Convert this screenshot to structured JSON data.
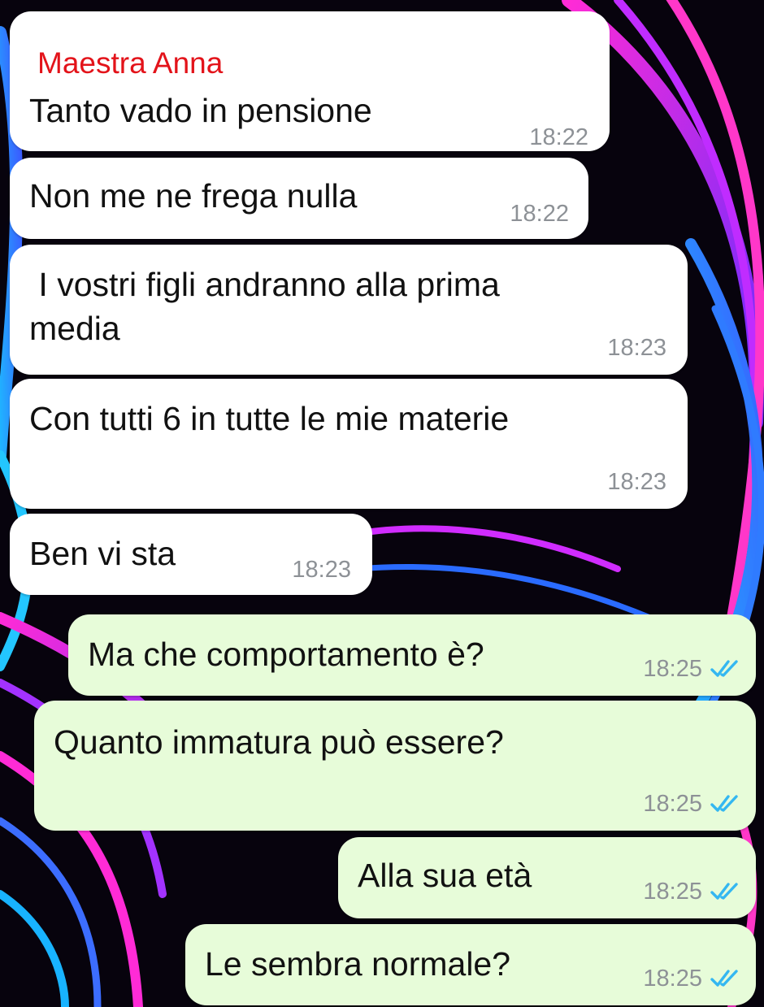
{
  "colors": {
    "incoming_bubble": "#ffffff",
    "outgoing_bubble": "#e7fcd9",
    "sender_name": "#e3131a",
    "timestamp": "#8d9196",
    "read_ticks": "#34b7f1"
  },
  "messages": [
    {
      "direction": "in",
      "sender": "Maestra Anna",
      "text": "Tanto vado in pensione",
      "time": "18:22"
    },
    {
      "direction": "in",
      "text": "Non me ne frega nulla",
      "time": "18:22"
    },
    {
      "direction": "in",
      "text": " I vostri figli andranno alla prima\nmedia",
      "time": "18:23"
    },
    {
      "direction": "in",
      "text": "Con tutti 6 in tutte le mie materie",
      "time": "18:23"
    },
    {
      "direction": "in",
      "text": "Ben vi sta",
      "time": "18:23"
    },
    {
      "direction": "out",
      "text": "Ma che comportamento è?",
      "time": "18:25",
      "status_icon": "double-check-read-icon"
    },
    {
      "direction": "out",
      "text": "Quanto immatura può essere?",
      "time": "18:25",
      "status_icon": "double-check-read-icon"
    },
    {
      "direction": "out",
      "text": "Alla sua età",
      "time": "18:25",
      "status_icon": "double-check-read-icon"
    },
    {
      "direction": "out",
      "text": "Le sembra normale?",
      "time": "18:25",
      "status_icon": "double-check-read-icon"
    }
  ]
}
